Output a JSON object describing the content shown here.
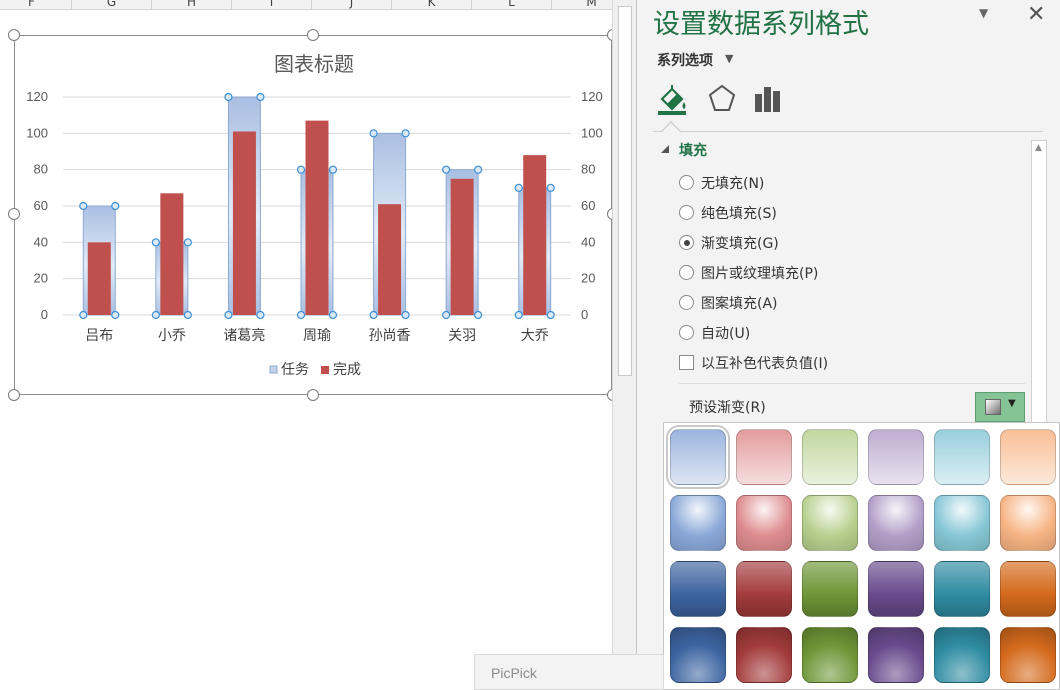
{
  "sheet": {
    "columns": [
      "F",
      "G",
      "H",
      "I",
      "J",
      "K",
      "L",
      "M"
    ]
  },
  "chart": {
    "title": "图表标题",
    "legend": {
      "task": "任务",
      "done": "完成"
    },
    "yticks": [
      "0",
      "20",
      "40",
      "60",
      "80",
      "100",
      "120"
    ],
    "colors": {
      "task_top": "#a9bfe2",
      "task_mid": "#e2ebf7",
      "done": "#c0504d",
      "grid": "#d9d9d9"
    }
  },
  "chart_data": {
    "type": "bar",
    "title": "图表标题",
    "categories": [
      "吕布",
      "小乔",
      "诸葛亮",
      "周瑜",
      "孙尚香",
      "关羽",
      "大乔"
    ],
    "series": [
      {
        "name": "任务",
        "values": [
          60,
          40,
          120,
          80,
          100,
          80,
          70
        ]
      },
      {
        "name": "完成",
        "values": [
          40,
          67,
          101,
          107,
          61,
          75,
          88
        ]
      }
    ],
    "ylim": [
      0,
      120
    ],
    "secondary_ylim": [
      0,
      120
    ],
    "ytick_step": 20,
    "grid": true,
    "legend_position": "bottom"
  },
  "pane": {
    "title": "设置数据系列格式",
    "series_options": "系列选项",
    "section_fill": "填充",
    "options": [
      {
        "label": "无填充(N)",
        "checked": false
      },
      {
        "label": "纯色填充(S)",
        "checked": false
      },
      {
        "label": "渐变填充(G)",
        "checked": true
      },
      {
        "label": "图片或纹理填充(P)",
        "checked": false
      },
      {
        "label": "图案填充(A)",
        "checked": false
      },
      {
        "label": "自动(U)",
        "checked": false
      }
    ],
    "invert_negative": "以互补色代表负值(I)",
    "preset_gradient": "预设渐变(R)"
  },
  "gallery": {
    "colors": [
      "#8aa8d8",
      "#de8c8e",
      "#b7d08e",
      "#b29fc8",
      "#86c7d6",
      "#f7b484"
    ],
    "dark_colors": [
      "#3d64a1",
      "#a33b3b",
      "#6e9637",
      "#684b8c",
      "#2f8ca2",
      "#d46a1c"
    ]
  },
  "taskbar": {
    "picpick": "PicPick"
  }
}
